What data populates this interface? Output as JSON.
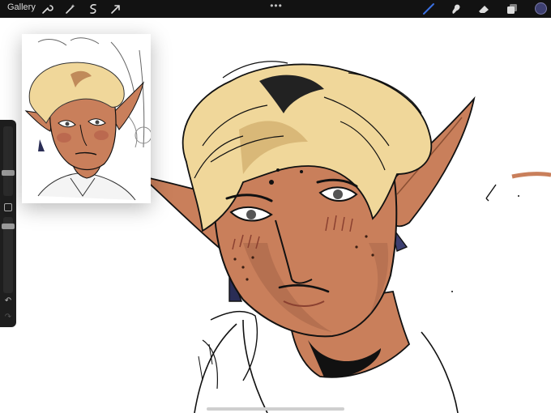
{
  "topbar": {
    "gallery_label": "Gallery",
    "left_tools": [
      "wrench-icon",
      "magic-wand-icon",
      "selection-icon",
      "transform-arrow-icon"
    ],
    "right_tools": [
      "brush-icon",
      "smudge-icon",
      "eraser-icon",
      "layers-icon"
    ],
    "active_tool": "brush-icon",
    "current_color": "#3d3f70"
  },
  "sidebar": {
    "brush_size_level": 0.45,
    "opacity_level": 0.85
  },
  "colors": {
    "skin": "#c97f5b",
    "hair": "#f0d79a",
    "hair_shadow": "#d9b878",
    "line": "#111111",
    "ui_accent": "#3a6fe0"
  }
}
